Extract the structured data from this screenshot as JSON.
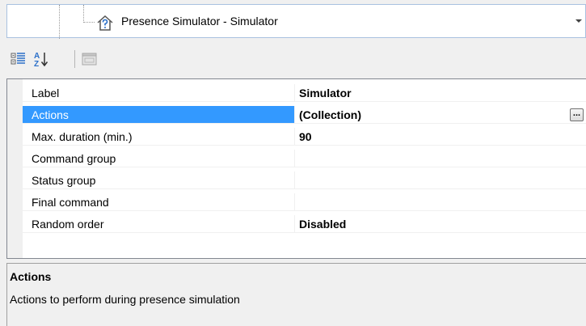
{
  "object_selector": {
    "selected_label": "Presence Simulator - Simulator",
    "icon": "house-question-icon"
  },
  "toolbar": {
    "buttons": [
      {
        "name": "categorized-view-button",
        "icon": "categorized-icon"
      },
      {
        "name": "alphabetical-sort-button",
        "icon": "sort-az-icon"
      },
      {
        "name": "property-pages-button",
        "icon": "property-pages-icon"
      }
    ]
  },
  "properties": [
    {
      "name": "Label",
      "value": "Simulator"
    },
    {
      "name": "Actions",
      "value": "(Collection)",
      "selected": true,
      "has_ellipsis": true,
      "ellipsis_label": "..."
    },
    {
      "name": "Max. duration (min.)",
      "value": "90"
    },
    {
      "name": "Command group",
      "value": ""
    },
    {
      "name": "Status group",
      "value": ""
    },
    {
      "name": "Final command",
      "value": ""
    },
    {
      "name": "Random order",
      "value": "Disabled"
    }
  ],
  "description": {
    "title": "Actions",
    "text": "Actions to perform during presence simulation"
  },
  "colors": {
    "selection": "#3399ff",
    "background": "#f0f0f0",
    "grid_background": "#ffffff"
  }
}
